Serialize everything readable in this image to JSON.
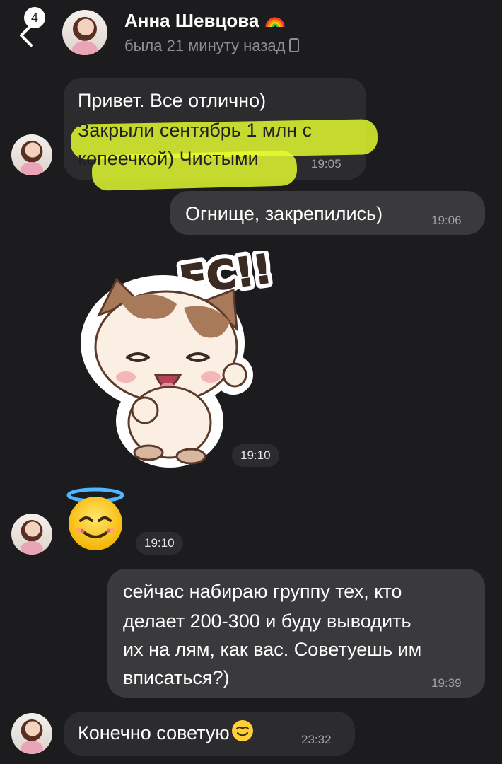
{
  "header": {
    "back_count": "4",
    "contact_name": "Анна Шевцова",
    "contact_emoji": "rainbow-icon",
    "status": "была 21 минуту назад"
  },
  "messages": [
    {
      "direction": "in",
      "lines": [
        "Привет. Все отлично)",
        "Закрыли сентябрь 1 млн с",
        "копеечкой) Чистыми"
      ],
      "time": "19:05"
    },
    {
      "direction": "out",
      "text": "Огнище, закрепились)",
      "time": "19:06"
    },
    {
      "direction": "in",
      "type": "sticker",
      "sticker_text": "ЕС!!",
      "time": "19:10"
    },
    {
      "direction": "in",
      "type": "emoji",
      "emoji": "smiling-face-with-halo",
      "time": "19:10"
    },
    {
      "direction": "out",
      "lines": [
        "сейчас набираю группу тех, кто",
        "делает 200-300 и буду выводить",
        "их на лям, как вас. Советуешь им",
        "вписаться?)"
      ],
      "time": "19:39"
    },
    {
      "direction": "in",
      "text": "Конечно советую",
      "time": "23:32"
    }
  ],
  "colors": {
    "background": "#1c1c1e",
    "bubble_in": "#2c2c2e",
    "bubble_out": "#3a3a3c",
    "highlight": "#e6ff2e"
  }
}
